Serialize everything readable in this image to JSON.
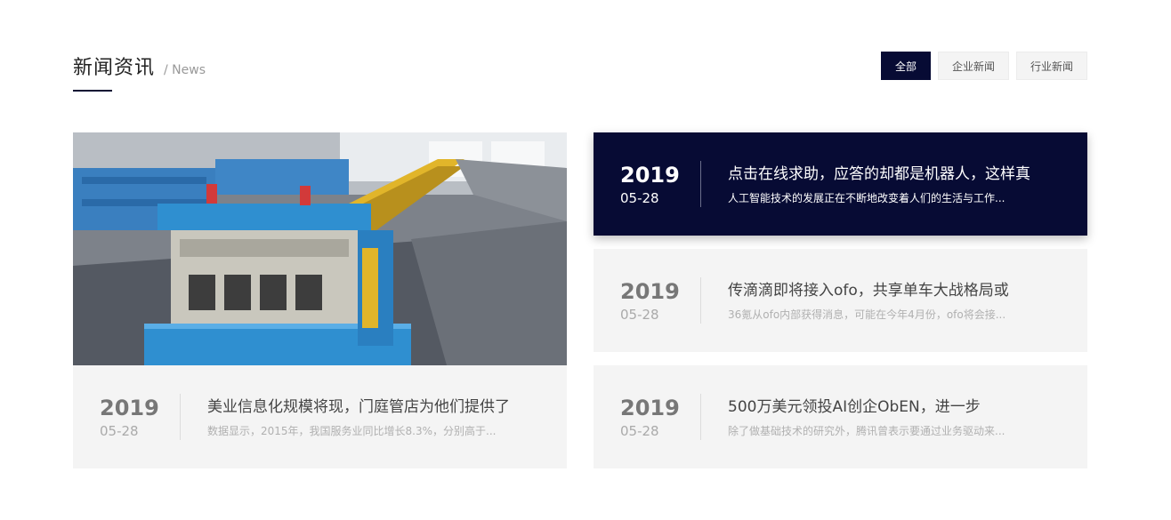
{
  "section": {
    "title": "新闻资讯",
    "subtitle": "/ News"
  },
  "tabs": [
    {
      "label": "全部"
    },
    {
      "label": "企业新闻"
    },
    {
      "label": "行业新闻"
    }
  ],
  "feature": {
    "year": "2019",
    "date": "05-28",
    "title": "美业信息化规模将现，门庭管店为他们提供了",
    "desc": "数据显示，2015年，我国服务业同比增长8.3%，分别高于..."
  },
  "list": [
    {
      "year": "2019",
      "date": "05-28",
      "title": "点击在线求助，应答的却都是机器人，这样真",
      "desc": "人工智能技术的发展正在不断地改变着人们的生活与工作..."
    },
    {
      "year": "2019",
      "date": "05-28",
      "title": "传滴滴即将接入ofo，共享单车大战格局或",
      "desc": "36氪从ofo内部获得消息，可能在今年4月份，ofo将会接..."
    },
    {
      "year": "2019",
      "date": "05-28",
      "title": "500万美元领投AI创企ObEN，进一步",
      "desc": "除了做基础技术的研究外，腾讯曾表示要通过业务驱动来..."
    }
  ],
  "colors": {
    "accent": "#070b34",
    "card_bg": "#f4f4f4",
    "machine_blue": "#2f8fd0",
    "rail_yellow": "#e1b52a"
  }
}
